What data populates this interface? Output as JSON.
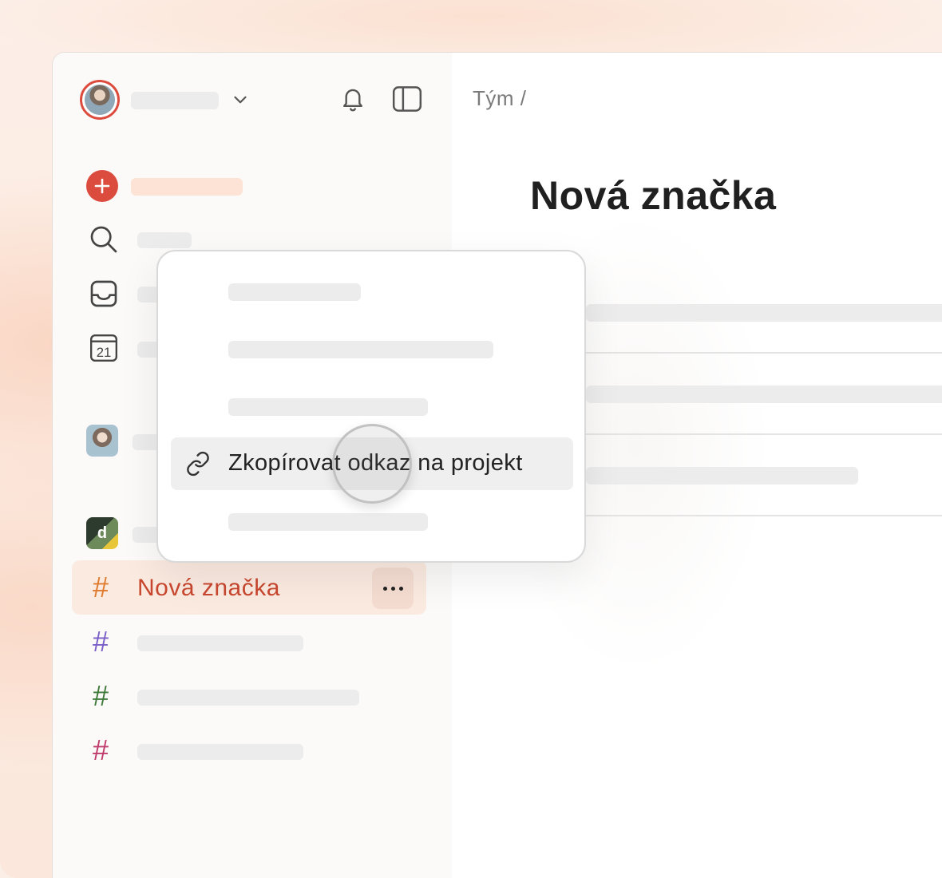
{
  "main": {
    "breadcrumb": "Tým /",
    "page_title": "Nová značka"
  },
  "sidebar": {
    "calendar_day": "21",
    "workspace_logo_letter": "d",
    "active_project": {
      "label": "Nová značka",
      "hash_color": "#e07a2c",
      "label_color": "#c9472f"
    },
    "project_hash_colors": [
      "#7a5fc8",
      "#3f7a3a",
      "#c03c6c"
    ],
    "hash_symbol": "#"
  },
  "context_menu": {
    "highlighted_item": {
      "label": "Zkopírovat odkaz na projekt",
      "icon": "link-icon"
    }
  },
  "colors": {
    "accent": "#dc4c3e",
    "active_bg": "#fbeae0"
  }
}
